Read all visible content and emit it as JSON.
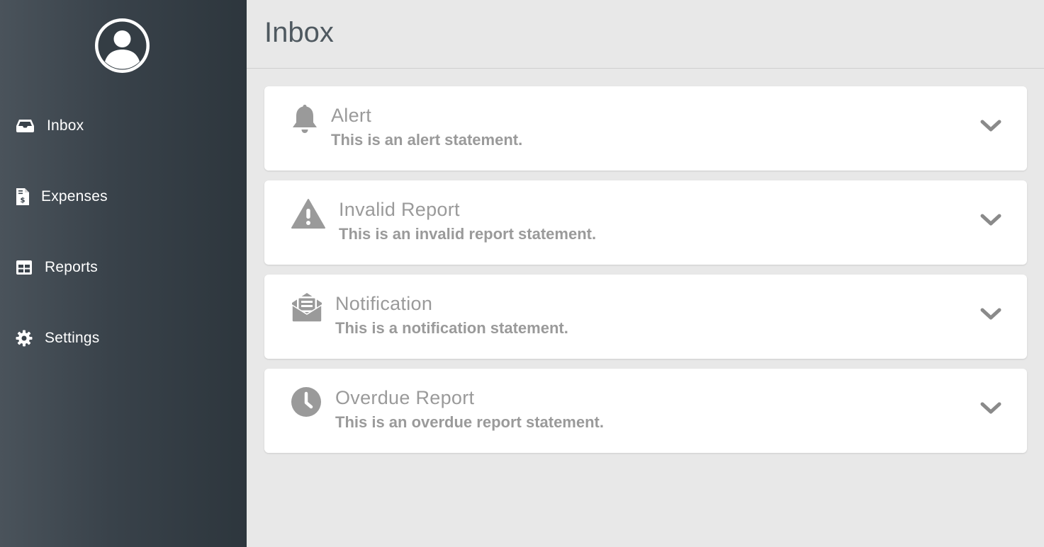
{
  "sidebar": {
    "items": [
      {
        "label": "Inbox",
        "icon": "inbox-icon"
      },
      {
        "label": "Expenses",
        "icon": "receipt-dollar-icon"
      },
      {
        "label": "Reports",
        "icon": "table-icon"
      },
      {
        "label": "Settings",
        "icon": "gear-icon"
      }
    ],
    "avatar_icon": "user-circle-icon"
  },
  "header": {
    "title": "Inbox"
  },
  "messages": [
    {
      "title": "Alert",
      "text": "This is an alert statement.",
      "icon": "bell-icon"
    },
    {
      "title": "Invalid Report",
      "text": "This is an invalid report statement.",
      "icon": "warning-triangle-icon"
    },
    {
      "title": "Notification",
      "text": "This is a notification statement.",
      "icon": "envelope-open-icon"
    },
    {
      "title": "Overdue Report",
      "text": "This is an overdue report statement.",
      "icon": "clock-icon"
    }
  ],
  "colors": {
    "sidebar_from": "#4a535b",
    "sidebar_to": "#2d363d",
    "background": "#e8e8e8",
    "card_text": "#9a9a9a",
    "title_text": "#4f5960"
  }
}
